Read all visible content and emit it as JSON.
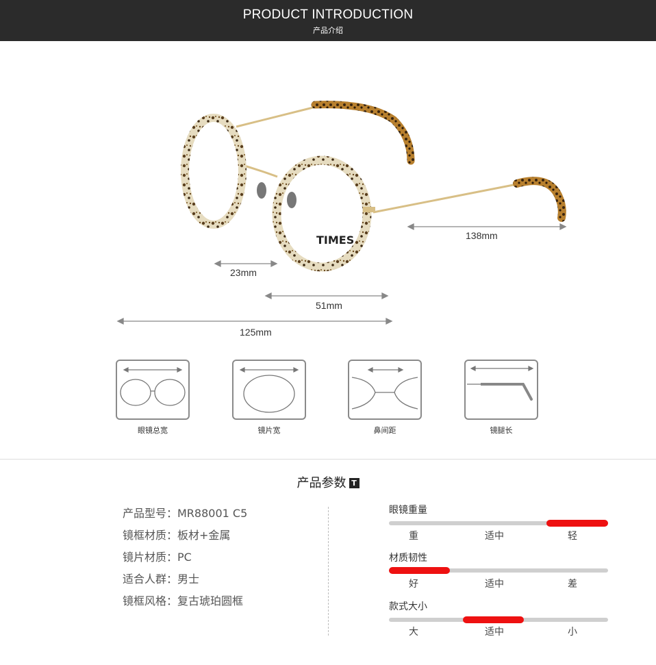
{
  "header": {
    "title_en": "PRODUCT INTRODUCTION",
    "title_cn": "产品介绍"
  },
  "photo": {
    "brand": "TIMES",
    "measurements": {
      "temple_length": "138mm",
      "nose_bridge": "23mm",
      "lens_width": "51mm",
      "total_width": "125mm"
    }
  },
  "icons": [
    {
      "label": "眼镜总宽"
    },
    {
      "label": "镜片宽"
    },
    {
      "label": "鼻间距"
    },
    {
      "label": "镜腿长"
    }
  ],
  "params": {
    "title": "产品参数",
    "badge": "T",
    "specs": [
      {
        "text": "产品型号：MR88001 C5"
      },
      {
        "text": "镜框材质：板材+金属"
      },
      {
        "text": "镜片材质：PC"
      },
      {
        "text": "适合人群：男士"
      },
      {
        "text": "镜框风格：复古琥珀圆框"
      }
    ],
    "ratings": [
      {
        "title": "眼镜重量",
        "ticks": [
          "重",
          "适中",
          "轻"
        ],
        "level": "轻"
      },
      {
        "title": "材质韧性",
        "ticks": [
          "好",
          "适中",
          "差"
        ],
        "level": "好"
      },
      {
        "title": "款式大小",
        "ticks": [
          "大",
          "适中",
          "小"
        ],
        "level": "适中"
      }
    ]
  },
  "colors": {
    "header_bg": "#2b2b2b",
    "accent": "#ee1111",
    "gold": "#d8bf86",
    "tortoise": "#6b4a1f"
  }
}
